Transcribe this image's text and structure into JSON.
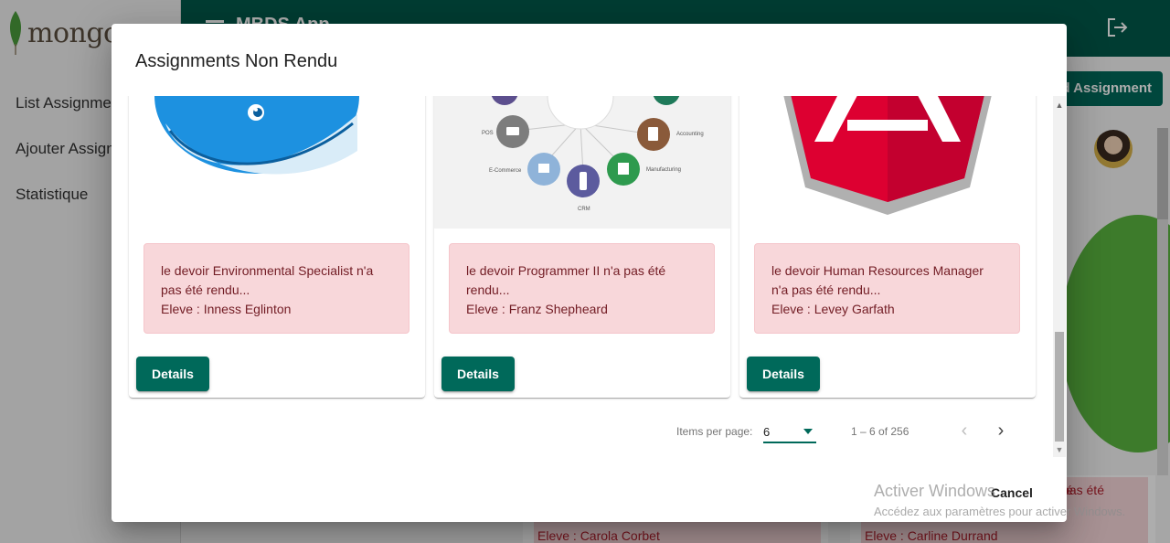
{
  "app": {
    "logo_text": "mongo",
    "toolbar_title": "MBDS App",
    "nav": [
      "List Assignments",
      "Ajouter Assignment",
      "Statistique"
    ],
    "add_button": "Add Assignment"
  },
  "background_cards": [
    {
      "line1": "pas été",
      "line2": "Eleve : Carola Corbet"
    },
    {
      "line1": "pas été",
      "line2": "Eleve : Carline Durrand"
    }
  ],
  "dialog": {
    "title": "Assignments Non Rendu",
    "cards": [
      {
        "image": "docker-whale-logo",
        "message": "le devoir Environmental Specialist n'a pas été rendu...",
        "student": "Eleve : Inness Eglinton",
        "button": "Details"
      },
      {
        "image": "erp-modules-diagram",
        "message": "le devoir Programmer II n'a pas été rendu...",
        "student": "Eleve : Franz Shepheard",
        "button": "Details"
      },
      {
        "image": "angular-logo",
        "message": "le devoir Human Resources Manager n'a pas été rendu...",
        "student": "Eleve : Levey Garfath",
        "button": "Details"
      }
    ],
    "diagram_labels": [
      "POS",
      "E-Commerce",
      "CRM",
      "Manufacturing",
      "Accounting"
    ],
    "paginator": {
      "label": "Items per page:",
      "page_size": "6",
      "range": "1 – 6 of 256"
    },
    "cancel": "Cancel"
  },
  "watermark": {
    "title": "Activer Windows",
    "subtitle": "Accédez aux paramètres pour activer Windows."
  },
  "colors": {
    "primary": "#00695a",
    "toolbar": "#00594a",
    "alert_bg": "#f8d7da",
    "alert_text": "#721c24"
  }
}
